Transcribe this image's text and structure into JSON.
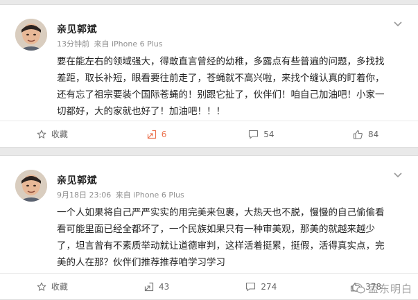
{
  "colors": {
    "accent": "#eb7350",
    "meta": "#8f8f8f",
    "text": "#222222"
  },
  "posts": [
    {
      "user": "亲见郭斌",
      "time": "13分钟前",
      "source": "来自 iPhone 6 Plus",
      "lines": [
        "要在能左右的领域强大，得敢直言曾经的幼稚，多露点有些普遍的问题，多找找",
        "差距，取长补短，眼看要往前走了，苍蝇就不高兴啦，来找个缝认真的盯着你，",
        "还有忘了祖宗要装个国际苍蝇的！别跟它扯了，伙伴们！咱自己加油吧！小家一",
        "切都好，大的家就也好了！加油吧！！！"
      ],
      "actions": {
        "favorite": "收藏",
        "repost": "6",
        "comment": "54",
        "like": "84"
      }
    },
    {
      "user": "亲见郭斌",
      "time": "9月18日 23:06",
      "source": "来自 iPhone 6 Plus",
      "lines": [
        "一个人如果将自己严严实实的用完美来包裹，大热天也不脱，慢慢的自己偷偷看",
        "看可能里面已经全都坏了，一个民族如果只有一种审美观，那美的就越来越少",
        "了，坦言曾有不素质举动就让道德审判，这样活着挺累，挺假，活得真实点，完",
        "美的人在那？伙伴们推荐推荐咱学习学习"
      ],
      "actions": {
        "favorite": "收藏",
        "repost": "43",
        "comment": "274",
        "like": "378"
      }
    }
  ],
  "watermark": "孟东明白"
}
